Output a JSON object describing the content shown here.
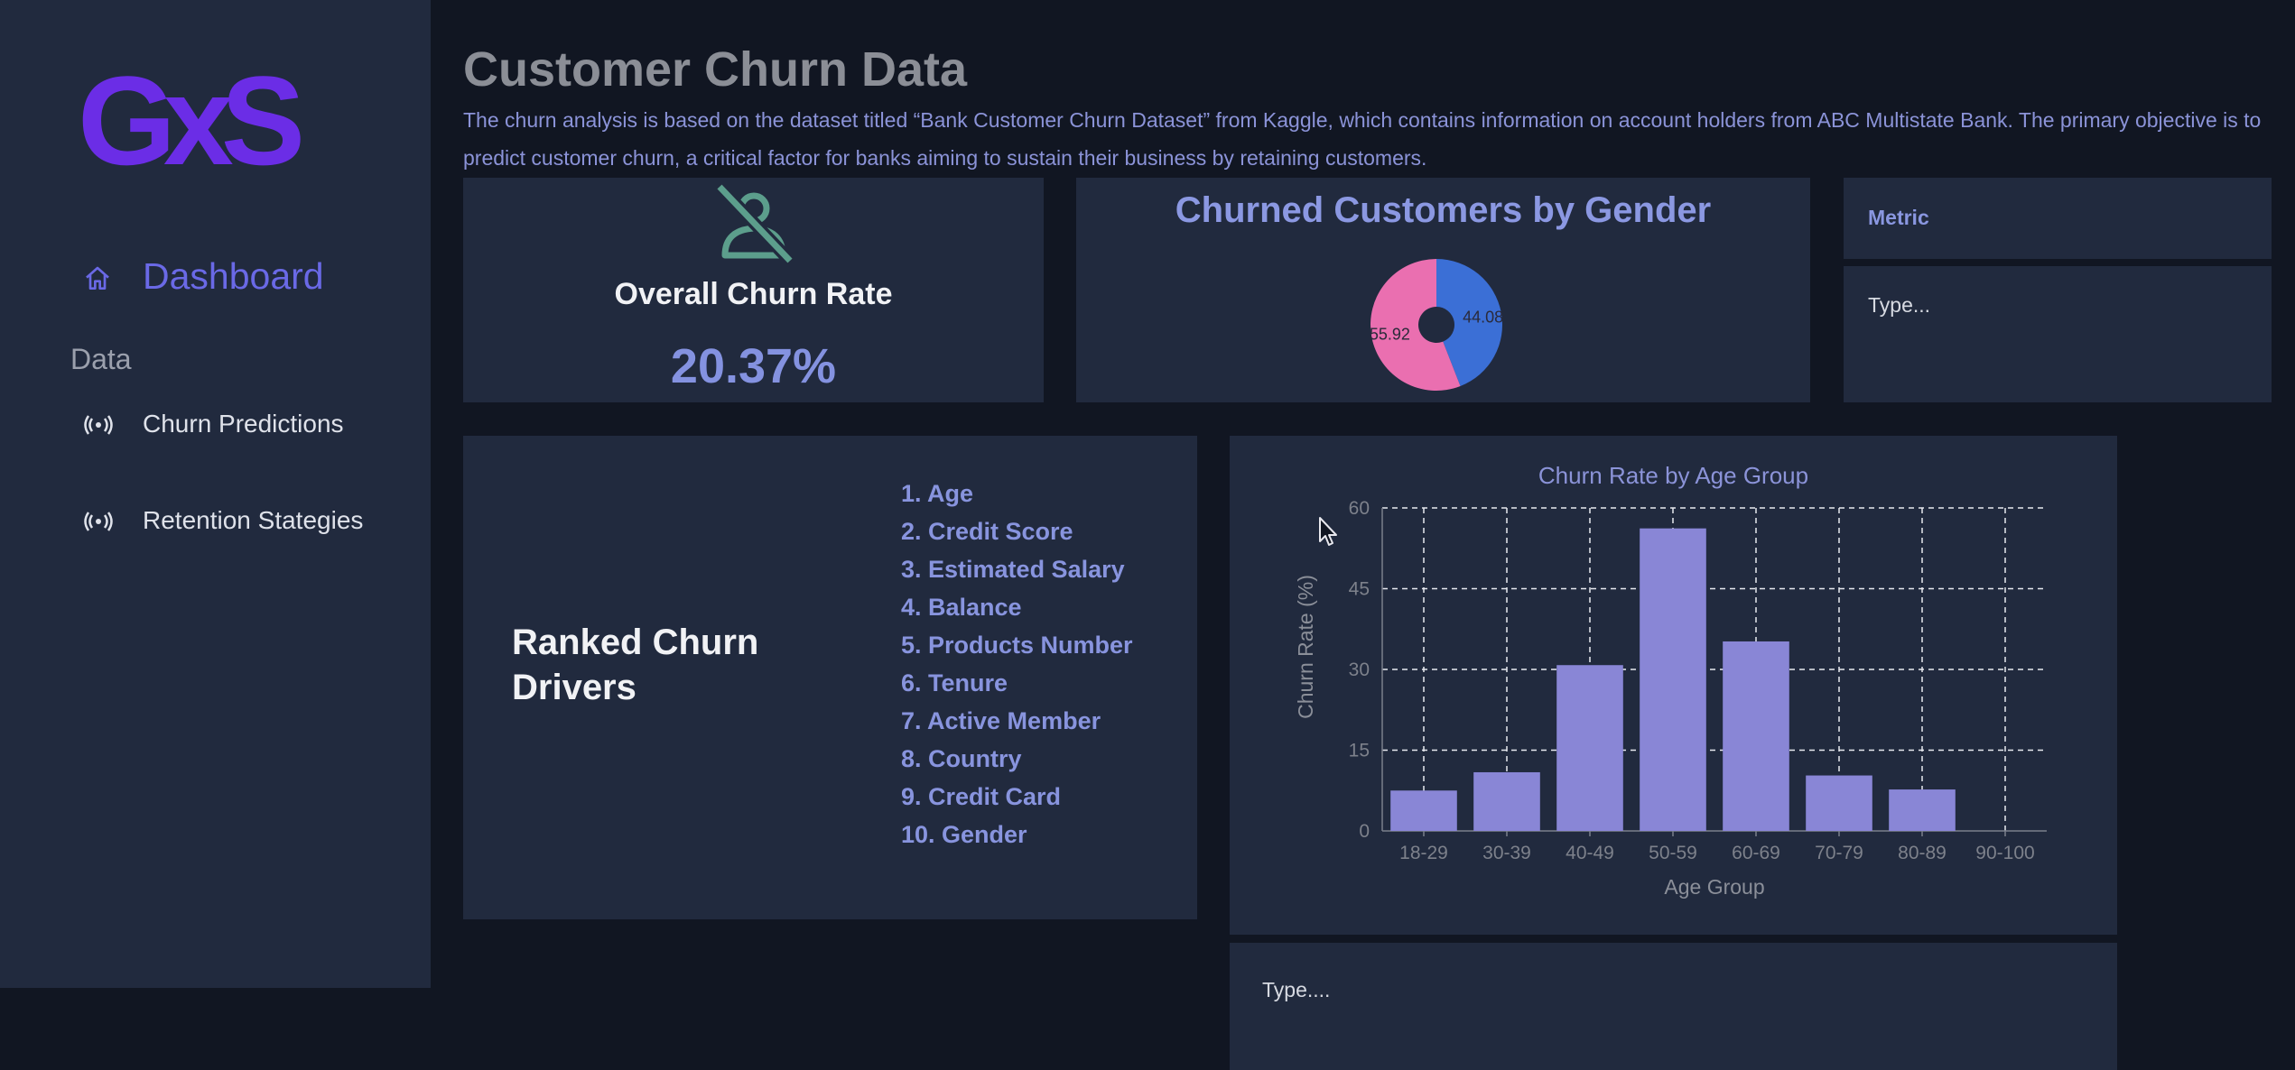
{
  "sidebar": {
    "logo_text": "GxS",
    "nav": {
      "dashboard": "Dashboard"
    },
    "section": "Data",
    "items": [
      {
        "label": "Churn Predictions",
        "icon": "broadcast-icon"
      },
      {
        "label": "Retention Stategies",
        "icon": "broadcast-icon"
      }
    ]
  },
  "header": {
    "title": "Customer Churn Data",
    "description": "The churn analysis is based on the dataset titled “Bank Customer Churn Dataset” from Kaggle, which contains information on account holders from ABC Multistate Bank. The primary objective is to predict customer churn, a critical factor for banks aiming to sustain their business by retaining customers."
  },
  "kpi": {
    "label": "Overall Churn Rate",
    "value": "20.37%",
    "icon": "user-slash-icon"
  },
  "pie": {
    "title": "Churned Customers by Gender",
    "slices": [
      {
        "label": "55.92",
        "value": 55.92,
        "color": "#ea6fb0"
      },
      {
        "label": "44.08",
        "value": 44.08,
        "color": "#3b6fd6"
      }
    ]
  },
  "metric": {
    "label": "Metric",
    "placeholder": "Type..."
  },
  "drivers": {
    "title": "Ranked Churn Drivers",
    "items": [
      "1. Age",
      "2. Credit Score",
      "3. Estimated Salary",
      "4. Balance",
      "5. Products Number",
      "6. Tenure",
      "7. Active Member",
      "8. Country",
      "9. Credit Card",
      "10. Gender"
    ]
  },
  "notes": {
    "placeholder": "Type...."
  },
  "colors": {
    "accent": "#6a69e6",
    "bar": "#8986d6",
    "card": "#212a3e",
    "bg": "#111622",
    "kpi_icon": "#5c9e8c"
  },
  "chart_data": {
    "type": "bar",
    "title": "Churn Rate by Age Group",
    "xlabel": "Age Group",
    "ylabel": "Churn Rate (%)",
    "categories": [
      "18-29",
      "30-39",
      "40-49",
      "50-59",
      "60-69",
      "70-79",
      "80-89",
      "90-100"
    ],
    "values": [
      7.5,
      10.9,
      30.8,
      56.2,
      35.2,
      10.3,
      7.7,
      0
    ],
    "ylim": [
      0,
      60
    ],
    "yticks": [
      0,
      15,
      30,
      45,
      60
    ],
    "grid": true
  }
}
